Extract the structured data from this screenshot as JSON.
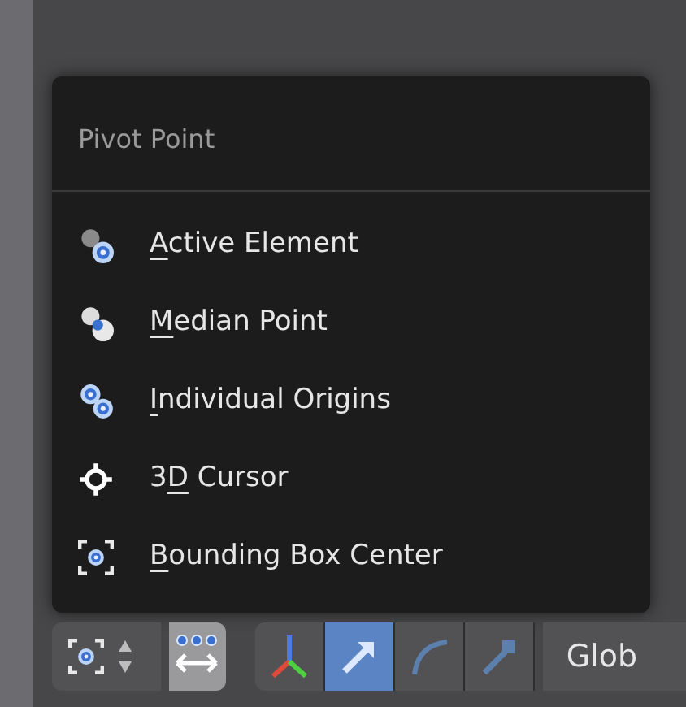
{
  "menu": {
    "title": "Pivot Point",
    "items": [
      {
        "kind": "active",
        "label": {
          "key": "A",
          "after": "ctive Element"
        }
      },
      {
        "kind": "median",
        "label": {
          "key": "M",
          "after": "edian Point"
        }
      },
      {
        "kind": "individual",
        "label": {
          "key": "I",
          "after": "ndividual Origins"
        }
      },
      {
        "kind": "cursor",
        "label": {
          "before": "3",
          "key": "D",
          "after": " Cursor"
        }
      },
      {
        "kind": "bounding",
        "label": {
          "key": "B",
          "after": "ounding Box Center"
        }
      }
    ]
  },
  "toolbar": {
    "pivot": {
      "kind": "bounding"
    },
    "proportional": {
      "selected": true
    },
    "manipulators": [
      {
        "kind": "axes",
        "selected": false
      },
      {
        "kind": "translate",
        "selected": true
      },
      {
        "kind": "rotate",
        "selected": false
      },
      {
        "kind": "scale",
        "selected": false
      }
    ],
    "orientation": {
      "label": "Glob"
    }
  }
}
